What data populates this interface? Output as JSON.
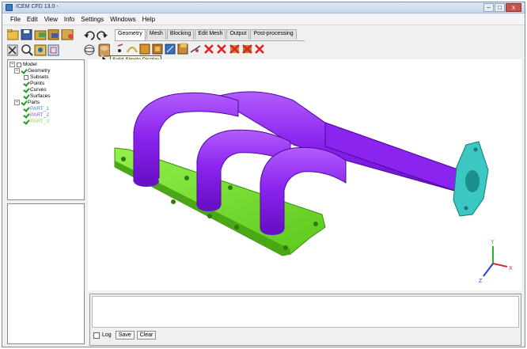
{
  "window": {
    "title": "ICEM CFD 13.0 -"
  },
  "window_controls": {
    "minimize": "–",
    "maximize": "□",
    "close": "x"
  },
  "menu": [
    "File",
    "Edit",
    "View",
    "Info",
    "Settings",
    "Windows",
    "Help"
  ],
  "toolbar_icons": [
    "open-icon",
    "save-icon",
    "open-geometry-icon",
    "save-geometry-icon",
    "quit-icon",
    "undo-icon",
    "redo-icon",
    "clear-icon",
    "zoom-icon",
    "measure-icon",
    "fit-window-icon",
    "wireframe-icon",
    "solid-display-icon"
  ],
  "tabs": [
    {
      "label": "Geometry",
      "active": true
    },
    {
      "label": "Mesh",
      "active": false
    },
    {
      "label": "Blocking",
      "active": false
    },
    {
      "label": "Edit Mesh",
      "active": false
    },
    {
      "label": "Output",
      "active": false
    },
    {
      "label": "Post-processing",
      "active": false
    }
  ],
  "tooltip": "Solid Simple Display",
  "tree": {
    "model": "Model",
    "geometry": "Geometry",
    "subsets": "Subsets",
    "points": "Points",
    "curves": "Curves",
    "surfaces": "Surfaces",
    "parts": "Parts",
    "part1": "PART_1",
    "part2": "PART_2",
    "part3": "PART_3"
  },
  "colors": {
    "part1": "#3a86c8",
    "part2": "#7a5cd8",
    "part3": "#8cdd4a",
    "pipe": "#9b38f0",
    "flange": "#76e42c",
    "end_flange": "#3cc7c2"
  },
  "axes": {
    "x": "X",
    "y": "Y",
    "z": "Z"
  },
  "console": {
    "log_label": "Log",
    "save_label": "Save",
    "clear_label": "Clear"
  }
}
